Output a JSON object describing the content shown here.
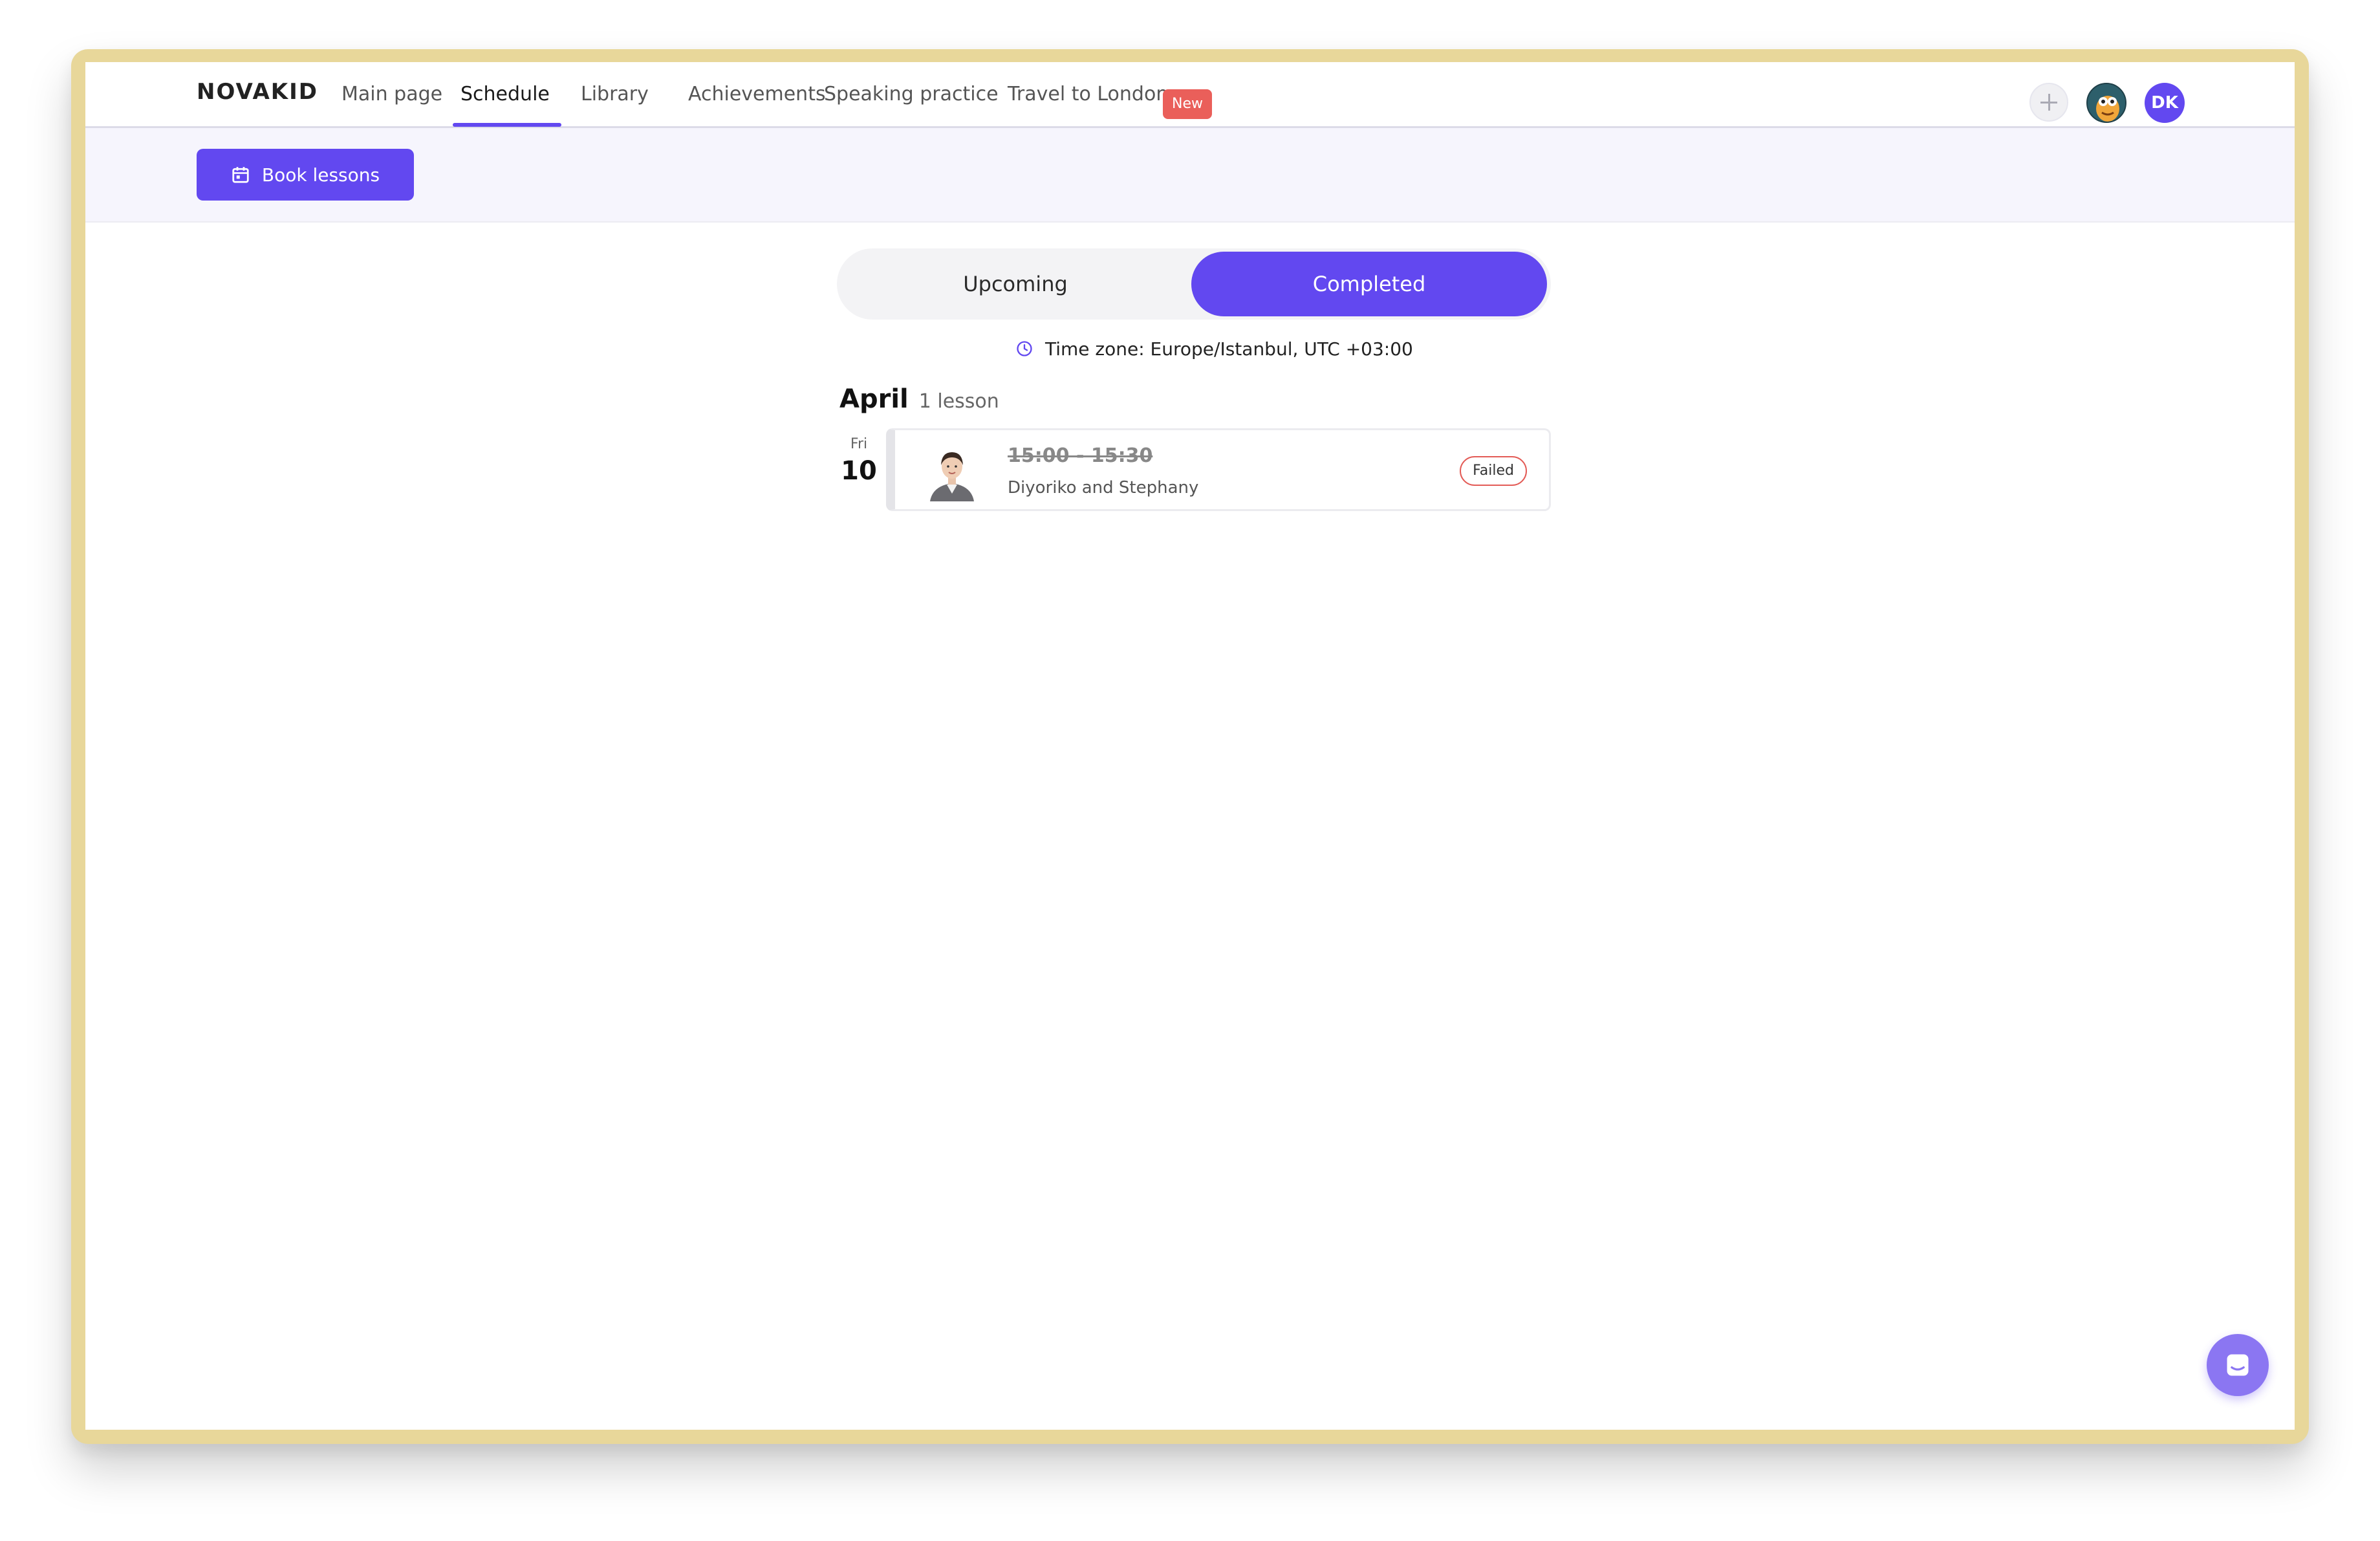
{
  "brand": {
    "logo_text": "NOVAKID"
  },
  "nav": {
    "items": [
      {
        "label": "Main page"
      },
      {
        "label": "Schedule"
      },
      {
        "label": "Library"
      },
      {
        "label": "Achievements"
      },
      {
        "label": "Speaking practice"
      },
      {
        "label": "Travel to London"
      }
    ],
    "new_badge": "New",
    "active": "Schedule"
  },
  "user": {
    "initials": "DK"
  },
  "toolbar": {
    "book_label": "Book lessons"
  },
  "tabs": {
    "upcoming": "Upcoming",
    "completed": "Completed",
    "selected": "Completed"
  },
  "timezone": "Time zone: Europe/Istanbul, UTC +03:00",
  "schedule": {
    "month": "April",
    "count": "1 lesson",
    "lessons": [
      {
        "day_name": "Fri",
        "day_num": "10",
        "time": "15:00 - 15:30",
        "names": "Diyoriko and Stephany",
        "status": "Failed"
      }
    ]
  },
  "colors": {
    "accent": "#6248f0",
    "failed": "#e35b56",
    "new_badge": "#ea5f5a"
  }
}
